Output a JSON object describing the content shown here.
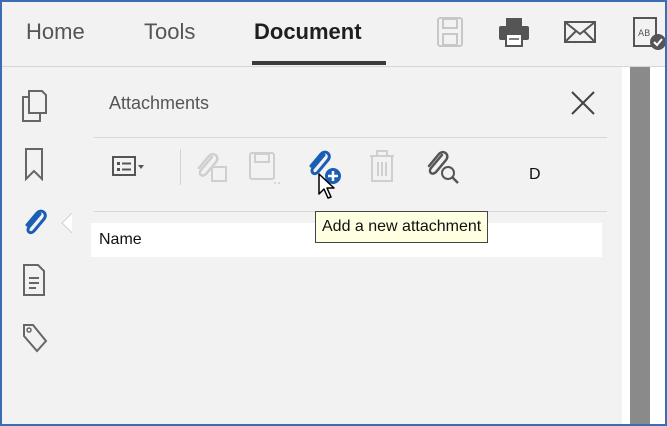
{
  "menubar": {
    "items": [
      {
        "label": "Home"
      },
      {
        "label": "Tools"
      },
      {
        "label": "Document"
      }
    ],
    "active_index": 2,
    "icons": [
      "save-icon",
      "print-icon",
      "email-icon",
      "document-check-icon"
    ]
  },
  "rail": {
    "icons": [
      "pages-icon",
      "bookmark-icon",
      "attachment-icon",
      "page-properties-icon",
      "tags-icon"
    ],
    "selected": "attachment-icon"
  },
  "panel": {
    "title": "Attachments",
    "close_icon": "close-icon",
    "toolbar_icons": [
      "view-options-icon",
      "open-attachment-icon",
      "save-attachment-icon",
      "add-attachment-icon",
      "delete-attachment-icon",
      "search-attachment-icon"
    ],
    "columns": {
      "name": "Name",
      "partial": "D"
    }
  },
  "tooltip": {
    "text": "Add a new attachment"
  },
  "colors": {
    "accent_blue": "#1a5fb4",
    "frame_blue": "#3a6db6",
    "tooltip_bg": "#ffffe1"
  }
}
